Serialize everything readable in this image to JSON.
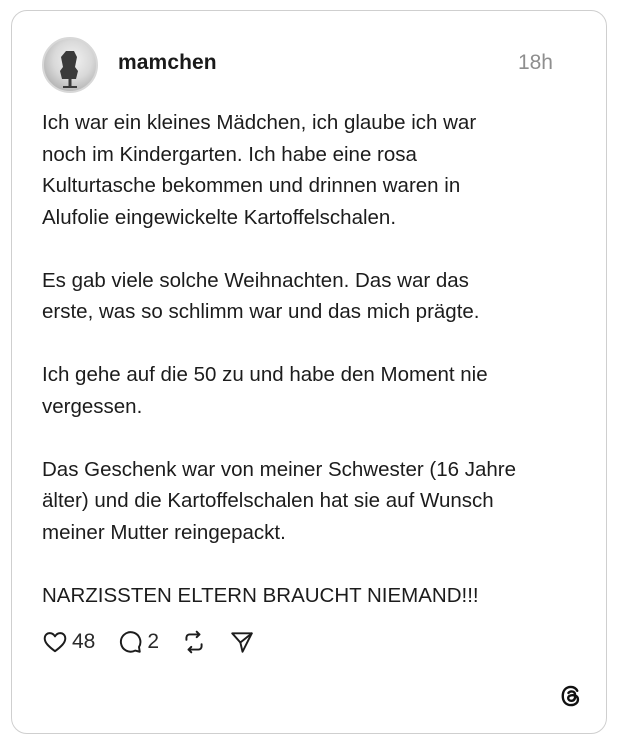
{
  "post": {
    "username": "mamchen",
    "time": "18h",
    "paragraphs": [
      "Ich war ein kleines Mädchen, ich glaube ich war\nnoch im Kindergarten. Ich habe eine rosa\nKulturtasche bekommen und drinnen waren in\nAlufolie eingewickelte Kartoffelschalen.",
      "Es gab viele solche Weihnachten. Das war das\nerste, was so schlimm war und das mich prägte.",
      "Ich gehe auf die 50 zu und habe den Moment nie\nvergessen.",
      "Das Geschenk war von meiner Schwester (16 Jahre\nälter) und die Kartoffelschalen hat sie auf Wunsch\nmeiner Mutter reingepackt.",
      "NARZISSTEN ELTERN BRAUCHT NIEMAND!!!"
    ]
  },
  "actions": {
    "like_count": "48",
    "reply_count": "2"
  },
  "icons": {
    "like": "heart-icon",
    "reply": "comment-bubble-icon",
    "repost": "repost-icon",
    "share": "send-icon",
    "brand": "threads-logo-icon"
  }
}
